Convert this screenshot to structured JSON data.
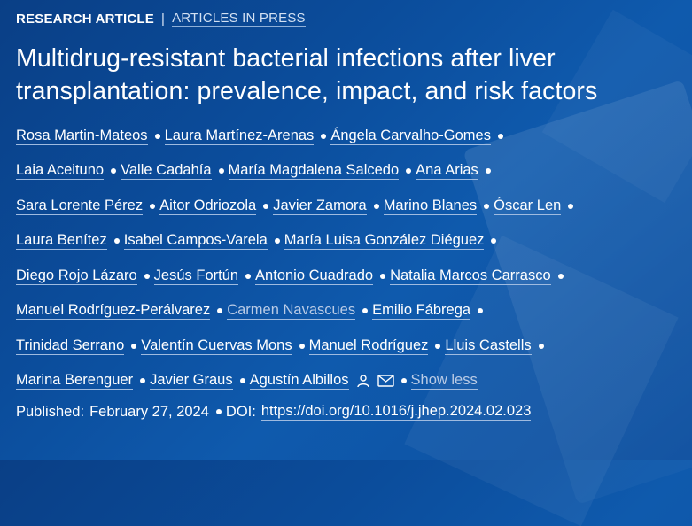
{
  "header": {
    "article_type": "RESEARCH ARTICLE",
    "separator": "|",
    "status_link": "ARTICLES IN PRESS"
  },
  "title": "Multidrug-resistant bacterial infections after liver transplantation: prevalence, impact, and risk factors",
  "authors": {
    "lines": [
      [
        "Rosa Martin-Mateos",
        "Laura Martínez-Arenas",
        "Ángela Carvalho-Gomes"
      ],
      [
        "Laia Aceituno",
        "Valle Cadahía",
        "María Magdalena Salcedo",
        "Ana Arias"
      ],
      [
        "Sara Lorente Pérez",
        "Aitor Odriozola",
        "Javier Zamora",
        "Marino Blanes",
        "Óscar Len"
      ],
      [
        "Laura Benítez",
        "Isabel Campos-Varela",
        "María Luisa González Diéguez"
      ],
      [
        "Diego Rojo Lázaro",
        "Jesús Fortún",
        "Antonio Cuadrado",
        "Natalia Marcos Carrasco"
      ],
      [
        "Manuel Rodríguez-Perálvarez",
        "Carmen Navascues",
        "Emilio Fábrega"
      ],
      [
        "Trinidad Serrano",
        "Valentín Cuervas Mons",
        "Manuel Rodríguez",
        "Lluis Castells"
      ],
      [
        "Marina Berenguer",
        "Javier Graus",
        "Agustín Albillos"
      ]
    ],
    "show_less_label": "Show less",
    "contact_icons": [
      "person-icon",
      "envelope-icon"
    ]
  },
  "publication": {
    "published_label": "Published:",
    "published_date": "February 27, 2024",
    "doi_label": "DOI:",
    "doi_url": "https://doi.org/10.1016/j.jhep.2024.02.023"
  },
  "colors": {
    "background": "#0b4d9c",
    "text": "#ffffff",
    "muted_link": "#b9cbe6"
  }
}
